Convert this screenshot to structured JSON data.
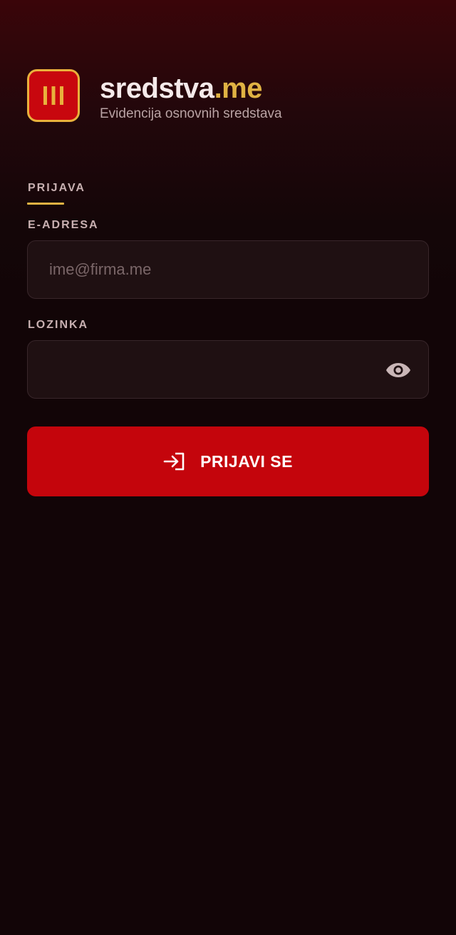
{
  "brand": {
    "name_main": "sredstva",
    "name_tld": ".me",
    "subtitle": "Evidencija osnovnih sredstava",
    "logo_icon": "three-bars-logo-icon"
  },
  "login": {
    "section_title": "PRIJAVA",
    "email": {
      "label": "E-ADRESA",
      "value": "",
      "placeholder": "ime@firma.me"
    },
    "password": {
      "label": "LOZINKA",
      "value": "",
      "placeholder": "",
      "toggle_icon": "eye-icon"
    },
    "submit": {
      "label": "PRIJAVI SE",
      "icon": "sign-in-icon"
    }
  },
  "colors": {
    "background": "#120507",
    "accent_gold": "#e0b243",
    "primary_red": "#c4050c",
    "input_bg": "#1f1012"
  }
}
